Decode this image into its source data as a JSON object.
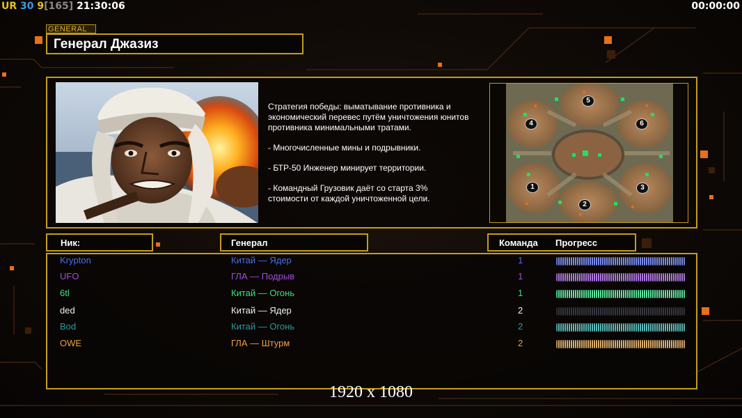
{
  "hud": {
    "ur": "UR",
    "fps": "30",
    "count": "9",
    "bracket_open": "[",
    "bracket_value": "165",
    "bracket_close": "]",
    "clock": "21:30:06",
    "timer": "00:00:00"
  },
  "tag": "GENERAL",
  "title": "Генерал Джазиз",
  "description": [
    "Стратегия победы: выматывание противника и\n экономический перевес путём уничтожения юнитов\n противника минимальными тратами.",
    "- Многочисленные мины и подрывники.",
    "- БТР-50 Инженер минирует территории.",
    "- Командный Грузовик даёт со старта 3%\n стоимости от каждой уничтоженной цели."
  ],
  "minimap": {
    "spawns": [
      "1",
      "2",
      "3",
      "4",
      "5",
      "6"
    ]
  },
  "headers": {
    "nick": "Ник:",
    "general": "Генерал",
    "team": "Команда",
    "progress": "Прогресс"
  },
  "players": [
    {
      "nick": "Krypton",
      "general": "Китай — Ядер",
      "team": "1",
      "color": "#4a6ee8",
      "bar": "#7f8ff0"
    },
    {
      "nick": "UFO",
      "general": "ГЛА — Подрыв",
      "team": "1",
      "color": "#a24cdc",
      "bar": "#b57ce6"
    },
    {
      "nick": "6tl",
      "general": "Китай — Огонь",
      "team": "1",
      "color": "#37e27a",
      "bar": "#5fe7a0"
    },
    {
      "nick": "ded",
      "general": "Китай — Ядер",
      "team": "2",
      "color": "#f2f2f2",
      "bar": "#383840"
    },
    {
      "nick": "Bod",
      "general": "Китай — Огонь",
      "team": "2",
      "color": "#2b9b9e",
      "bar": "#5fbcbc"
    },
    {
      "nick": "OWE",
      "general": "ГЛА — Штурм",
      "team": "2",
      "color": "#f0a040",
      "bar": "#e0b070"
    }
  ],
  "resolution": "1920 x 1080"
}
